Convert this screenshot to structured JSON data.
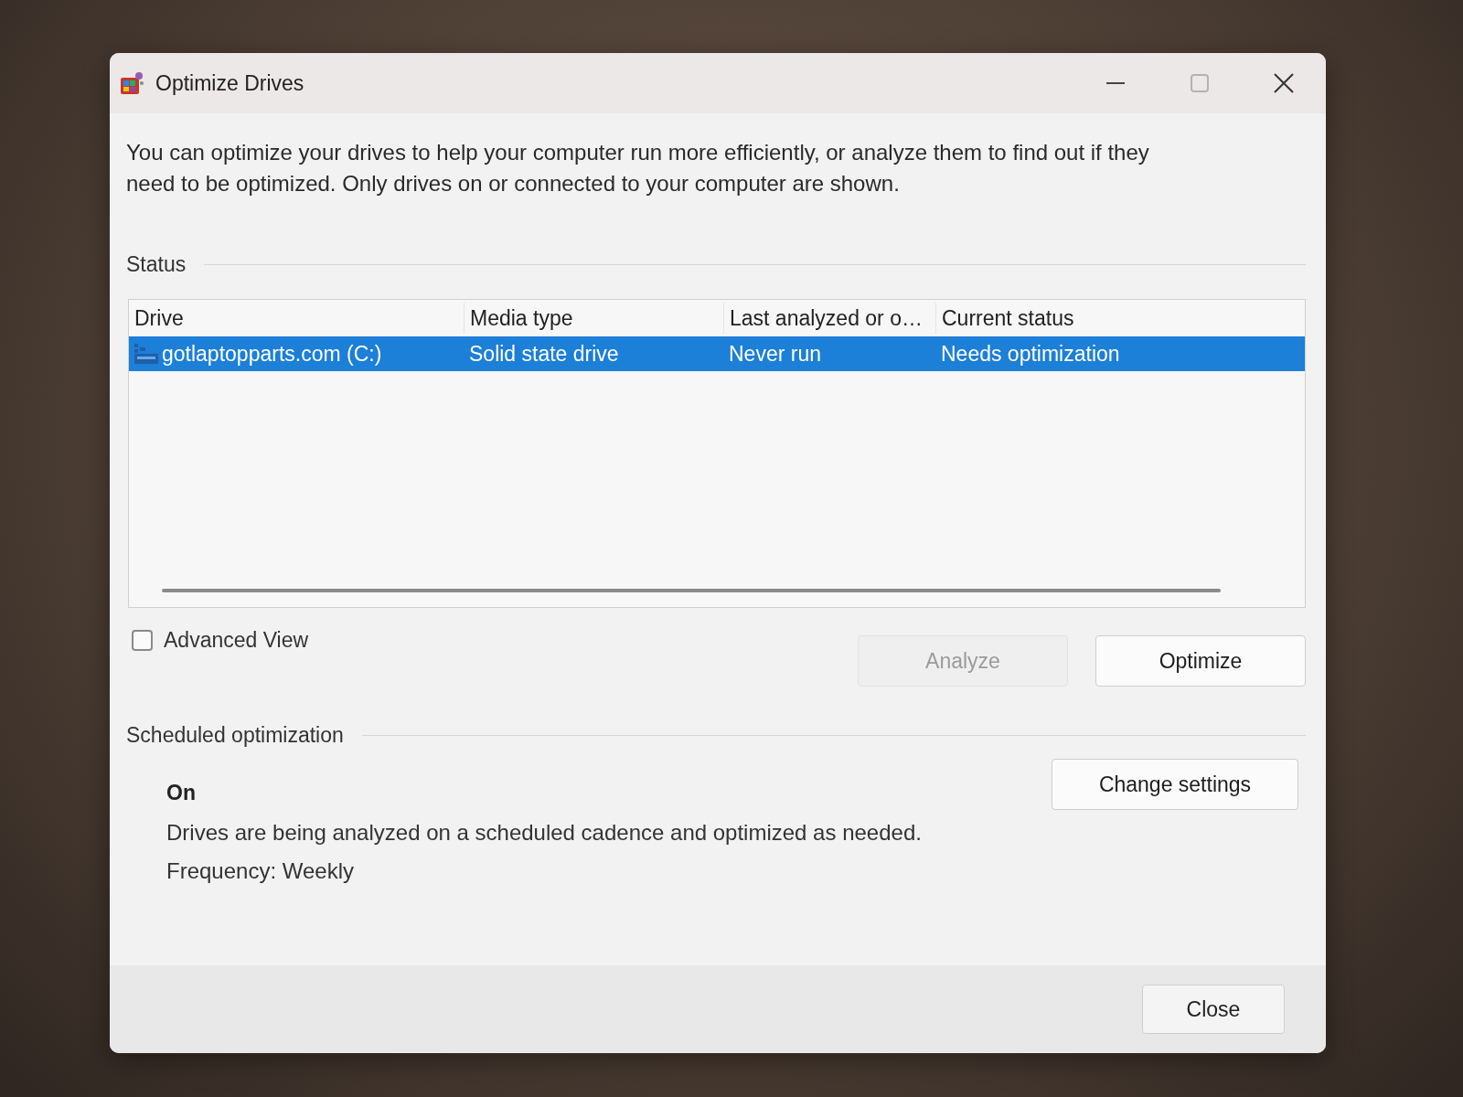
{
  "window": {
    "title": "Optimize Drives"
  },
  "description": "You can optimize your drives to help your computer run more efficiently, or analyze them to find out if they need to be optimized. Only drives on or connected to your computer are shown.",
  "status": {
    "label": "Status",
    "table": {
      "columns": [
        "Drive",
        "Media type",
        "Last analyzed or o…",
        "Current status"
      ],
      "rows": [
        {
          "cells": [
            "gotlaptopparts.com (C:)",
            "Solid state drive",
            "Never run",
            "Needs optimization"
          ],
          "selected": true
        }
      ]
    }
  },
  "advanced_view": {
    "label": "Advanced View",
    "checked": false
  },
  "actions": [
    {
      "label": "Analyze",
      "disabled": true
    },
    {
      "label": "Optimize",
      "disabled": false
    }
  ],
  "scheduled": {
    "label": "Scheduled optimization",
    "state": "On",
    "description": "Drives are being analyzed on a scheduled cadence and optimized as needed.",
    "frequency": "Frequency: Weekly",
    "button": {
      "label": "Change settings"
    }
  },
  "footer": {
    "buttons": [
      {
        "label": "Close"
      }
    ]
  }
}
